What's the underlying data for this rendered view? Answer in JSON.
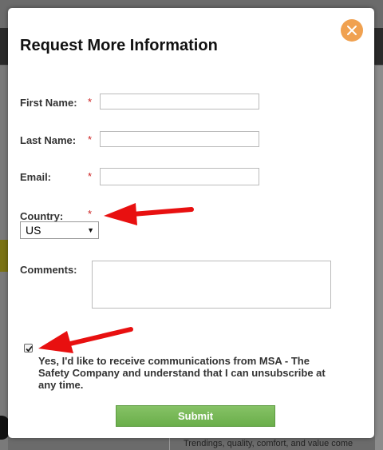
{
  "background": {
    "snippet_text": "Trendings, quality, comfort, and value come together in the Workman line of"
  },
  "modal": {
    "title": "Request More Information",
    "close_icon": "close-icon",
    "fields": {
      "first_name_label": "First Name:",
      "last_name_label": "Last Name:",
      "email_label": "Email:",
      "country_label": "Country:",
      "country_value": "US",
      "comments_label": "Comments:",
      "required_marker": "*"
    },
    "consent": {
      "checked": true,
      "text": "Yes, I'd like to receive communications from MSA - The Safety Company and understand that I can unsubscribe at any time."
    },
    "submit_label": "Submit",
    "colors": {
      "close": "#f0a150",
      "submit": "#77b757",
      "required": "#cc1f1f",
      "annotation_arrow": "#e81010"
    }
  }
}
